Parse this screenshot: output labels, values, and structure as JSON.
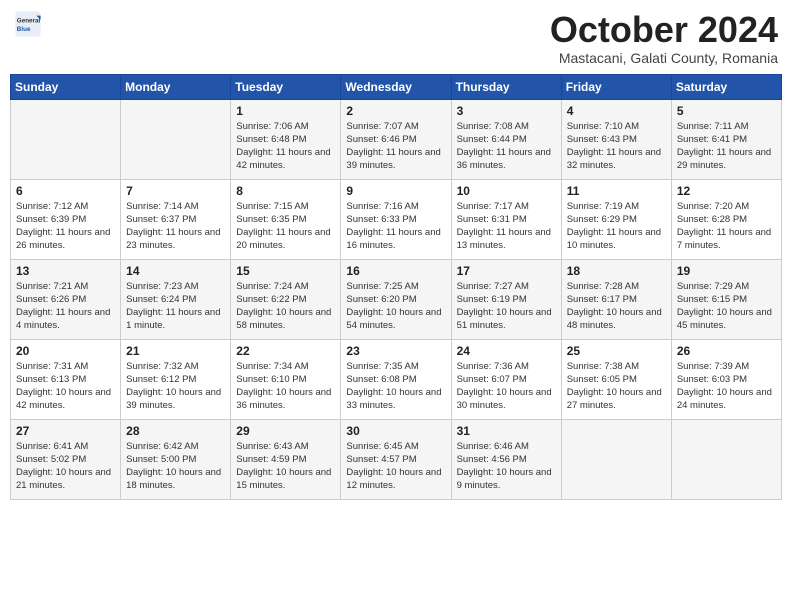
{
  "header": {
    "logo_general": "General",
    "logo_blue": "Blue",
    "month": "October 2024",
    "location": "Mastacani, Galati County, Romania"
  },
  "weekdays": [
    "Sunday",
    "Monday",
    "Tuesday",
    "Wednesday",
    "Thursday",
    "Friday",
    "Saturday"
  ],
  "weeks": [
    [
      {
        "day": "",
        "info": ""
      },
      {
        "day": "",
        "info": ""
      },
      {
        "day": "1",
        "info": "Sunrise: 7:06 AM\nSunset: 6:48 PM\nDaylight: 11 hours and 42 minutes."
      },
      {
        "day": "2",
        "info": "Sunrise: 7:07 AM\nSunset: 6:46 PM\nDaylight: 11 hours and 39 minutes."
      },
      {
        "day": "3",
        "info": "Sunrise: 7:08 AM\nSunset: 6:44 PM\nDaylight: 11 hours and 36 minutes."
      },
      {
        "day": "4",
        "info": "Sunrise: 7:10 AM\nSunset: 6:43 PM\nDaylight: 11 hours and 32 minutes."
      },
      {
        "day": "5",
        "info": "Sunrise: 7:11 AM\nSunset: 6:41 PM\nDaylight: 11 hours and 29 minutes."
      }
    ],
    [
      {
        "day": "6",
        "info": "Sunrise: 7:12 AM\nSunset: 6:39 PM\nDaylight: 11 hours and 26 minutes."
      },
      {
        "day": "7",
        "info": "Sunrise: 7:14 AM\nSunset: 6:37 PM\nDaylight: 11 hours and 23 minutes."
      },
      {
        "day": "8",
        "info": "Sunrise: 7:15 AM\nSunset: 6:35 PM\nDaylight: 11 hours and 20 minutes."
      },
      {
        "day": "9",
        "info": "Sunrise: 7:16 AM\nSunset: 6:33 PM\nDaylight: 11 hours and 16 minutes."
      },
      {
        "day": "10",
        "info": "Sunrise: 7:17 AM\nSunset: 6:31 PM\nDaylight: 11 hours and 13 minutes."
      },
      {
        "day": "11",
        "info": "Sunrise: 7:19 AM\nSunset: 6:29 PM\nDaylight: 11 hours and 10 minutes."
      },
      {
        "day": "12",
        "info": "Sunrise: 7:20 AM\nSunset: 6:28 PM\nDaylight: 11 hours and 7 minutes."
      }
    ],
    [
      {
        "day": "13",
        "info": "Sunrise: 7:21 AM\nSunset: 6:26 PM\nDaylight: 11 hours and 4 minutes."
      },
      {
        "day": "14",
        "info": "Sunrise: 7:23 AM\nSunset: 6:24 PM\nDaylight: 11 hours and 1 minute."
      },
      {
        "day": "15",
        "info": "Sunrise: 7:24 AM\nSunset: 6:22 PM\nDaylight: 10 hours and 58 minutes."
      },
      {
        "day": "16",
        "info": "Sunrise: 7:25 AM\nSunset: 6:20 PM\nDaylight: 10 hours and 54 minutes."
      },
      {
        "day": "17",
        "info": "Sunrise: 7:27 AM\nSunset: 6:19 PM\nDaylight: 10 hours and 51 minutes."
      },
      {
        "day": "18",
        "info": "Sunrise: 7:28 AM\nSunset: 6:17 PM\nDaylight: 10 hours and 48 minutes."
      },
      {
        "day": "19",
        "info": "Sunrise: 7:29 AM\nSunset: 6:15 PM\nDaylight: 10 hours and 45 minutes."
      }
    ],
    [
      {
        "day": "20",
        "info": "Sunrise: 7:31 AM\nSunset: 6:13 PM\nDaylight: 10 hours and 42 minutes."
      },
      {
        "day": "21",
        "info": "Sunrise: 7:32 AM\nSunset: 6:12 PM\nDaylight: 10 hours and 39 minutes."
      },
      {
        "day": "22",
        "info": "Sunrise: 7:34 AM\nSunset: 6:10 PM\nDaylight: 10 hours and 36 minutes."
      },
      {
        "day": "23",
        "info": "Sunrise: 7:35 AM\nSunset: 6:08 PM\nDaylight: 10 hours and 33 minutes."
      },
      {
        "day": "24",
        "info": "Sunrise: 7:36 AM\nSunset: 6:07 PM\nDaylight: 10 hours and 30 minutes."
      },
      {
        "day": "25",
        "info": "Sunrise: 7:38 AM\nSunset: 6:05 PM\nDaylight: 10 hours and 27 minutes."
      },
      {
        "day": "26",
        "info": "Sunrise: 7:39 AM\nSunset: 6:03 PM\nDaylight: 10 hours and 24 minutes."
      }
    ],
    [
      {
        "day": "27",
        "info": "Sunrise: 6:41 AM\nSunset: 5:02 PM\nDaylight: 10 hours and 21 minutes."
      },
      {
        "day": "28",
        "info": "Sunrise: 6:42 AM\nSunset: 5:00 PM\nDaylight: 10 hours and 18 minutes."
      },
      {
        "day": "29",
        "info": "Sunrise: 6:43 AM\nSunset: 4:59 PM\nDaylight: 10 hours and 15 minutes."
      },
      {
        "day": "30",
        "info": "Sunrise: 6:45 AM\nSunset: 4:57 PM\nDaylight: 10 hours and 12 minutes."
      },
      {
        "day": "31",
        "info": "Sunrise: 6:46 AM\nSunset: 4:56 PM\nDaylight: 10 hours and 9 minutes."
      },
      {
        "day": "",
        "info": ""
      },
      {
        "day": "",
        "info": ""
      }
    ]
  ]
}
